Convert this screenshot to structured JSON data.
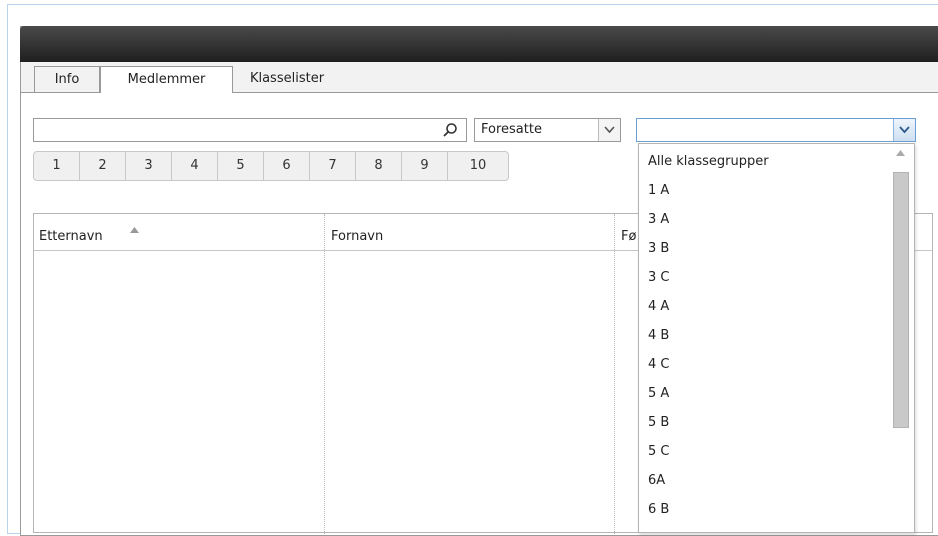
{
  "tabs": [
    {
      "label": "Info"
    },
    {
      "label": "Medlemmer"
    },
    {
      "label": "Klasselister"
    }
  ],
  "search": {
    "value": "",
    "placeholder": ""
  },
  "filter_type": {
    "value": "Foresatte"
  },
  "class_filter": {
    "value": ""
  },
  "pager": [
    "1",
    "2",
    "3",
    "4",
    "5",
    "6",
    "7",
    "8",
    "9",
    "10"
  ],
  "grid": {
    "columns": [
      {
        "label": "Etternavn",
        "sorted": "asc"
      },
      {
        "label": "Fornavn"
      },
      {
        "label": "Fø"
      }
    ],
    "rows": []
  },
  "class_options": [
    "Alle klassegrupper",
    "1 A",
    "3 A",
    "3 B",
    "3 C",
    "4 A",
    "4 B",
    "4 C",
    "5 A",
    "5 B",
    "5 C",
    "6A",
    "6 B"
  ],
  "colors": {
    "titlebar": "#2b2b2b",
    "active_border": "#6a9fd4",
    "grid_border": "#b5b5b5"
  }
}
